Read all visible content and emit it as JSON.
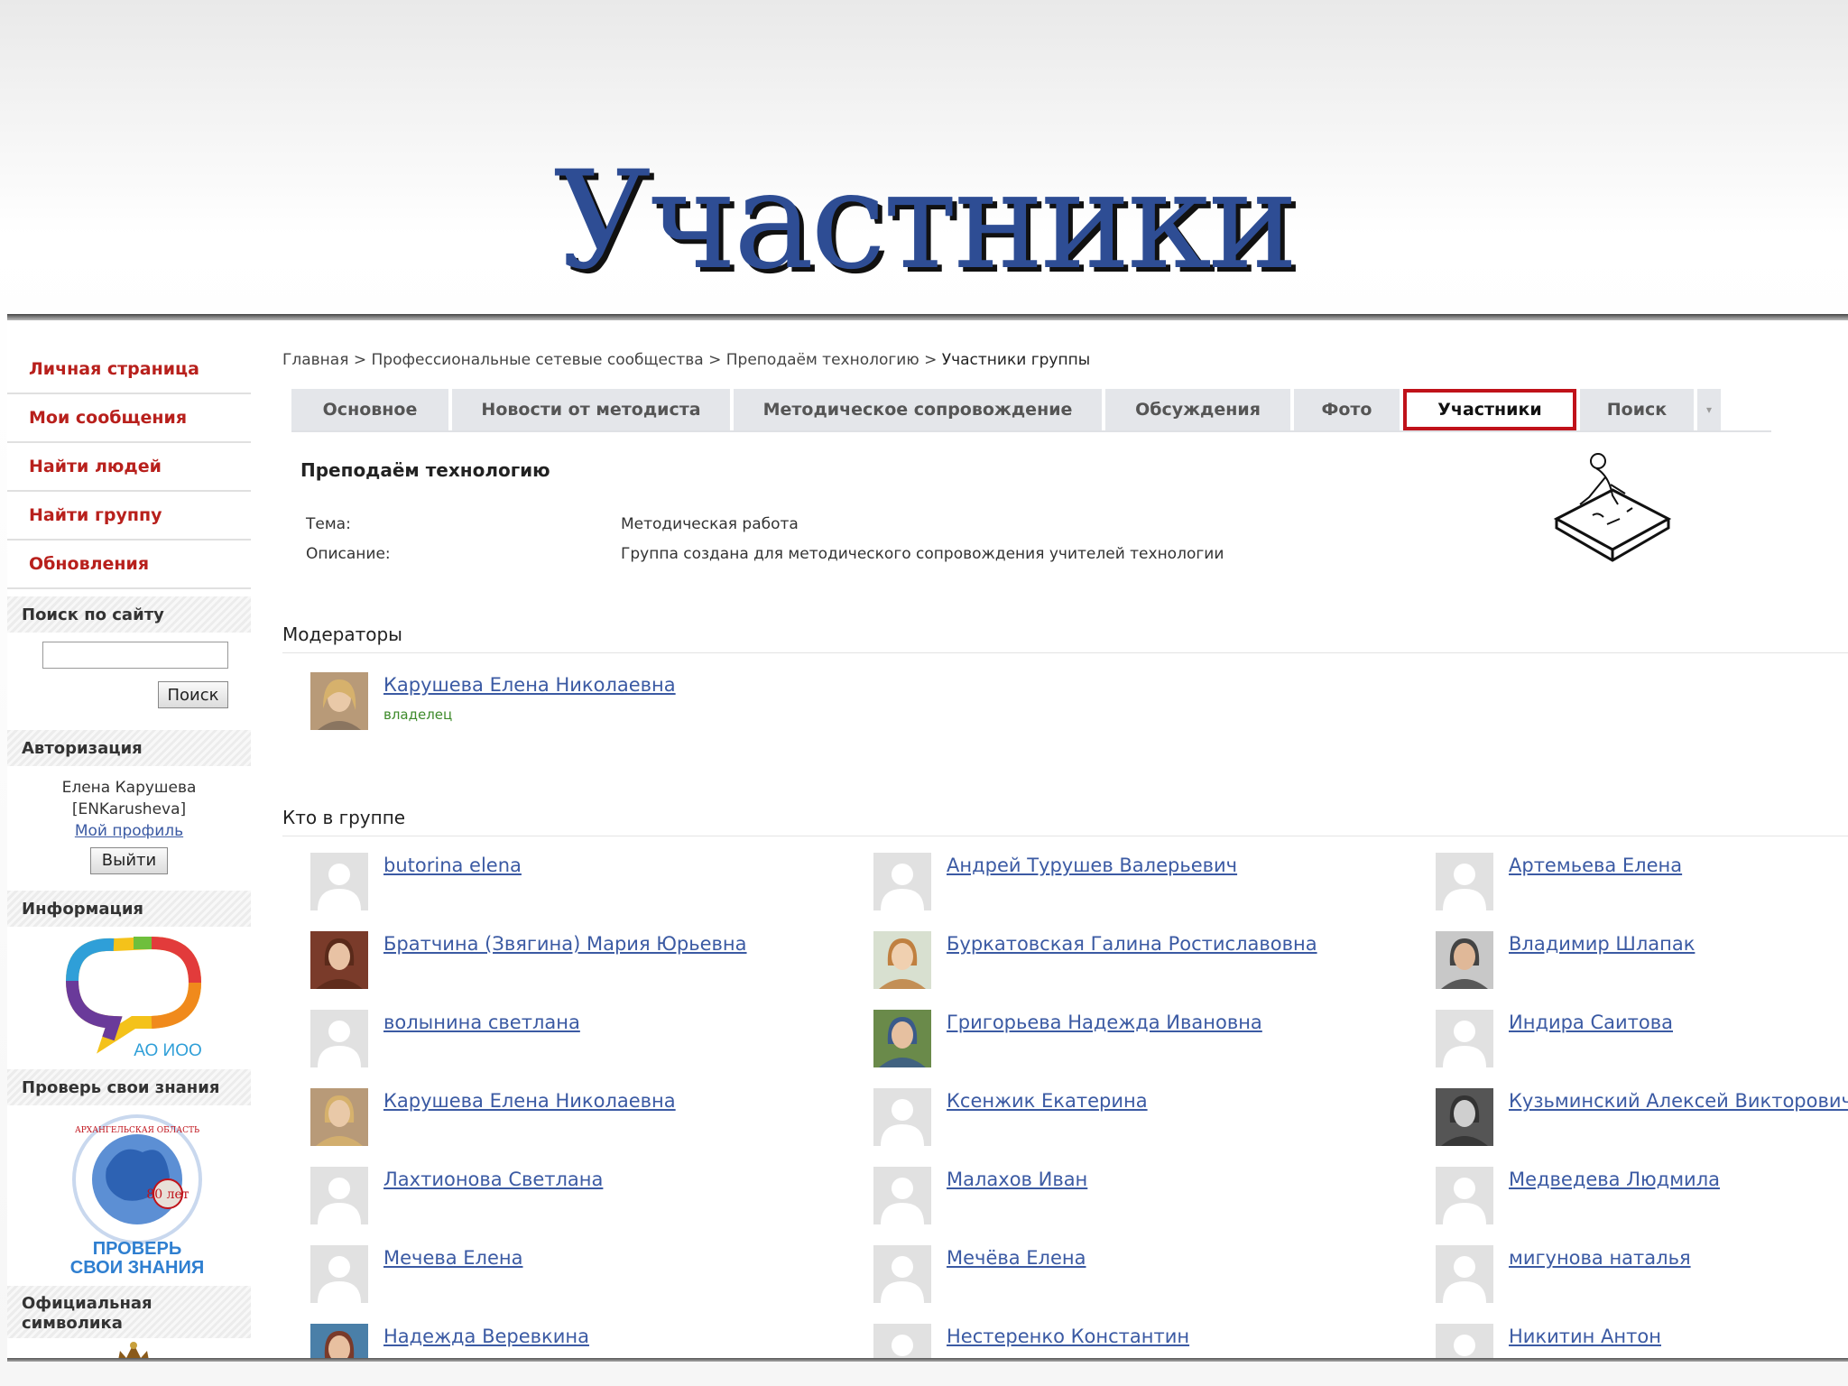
{
  "slide": {
    "title": "Участники"
  },
  "sidebar": {
    "nav": [
      "Личная страница",
      "Мои сообщения",
      "Найти людей",
      "Найти группу",
      "Обновления"
    ],
    "search": {
      "heading": "Поиск по сайту",
      "value": "",
      "button": "Поиск"
    },
    "auth": {
      "heading": "Авторизация",
      "name": "Елена Карушева",
      "login": "[ENKarusheva]",
      "profile_link": "Мой профиль",
      "logout": "Выйти"
    },
    "info": {
      "heading": "Информация",
      "logo_caption": "АО ИОО"
    },
    "quiz": {
      "heading": "Проверь свои знания",
      "line1": "ПРОВЕРЬ",
      "line2": "СВОИ ЗНАНИЯ",
      "seal_text": "АРХАНГЕЛЬСКАЯ ОБЛАСТЬ",
      "seal_years": "80 лет"
    },
    "symbols": {
      "heading_line1": "Официальная",
      "heading_line2": "символика"
    }
  },
  "breadcrumb": {
    "home": "Главная",
    "sep": ">",
    "level2": "Профессиональные сетевые сообщества",
    "level3": "Преподаём технологию",
    "current": "Участники группы"
  },
  "tabs": [
    "Основное",
    "Новости от методиста",
    "Методическое сопровождение",
    "Обсуждения",
    "Фото",
    "Участники",
    "Поиск"
  ],
  "active_tab": "Участники",
  "group": {
    "name": "Преподаём технологию",
    "topic_label": "Тема:",
    "topic": "Методическая работа",
    "desc_label": "Описание:",
    "desc": "Группа создана для методического сопровождения учителей технологии"
  },
  "moderators": {
    "heading": "Модераторы",
    "items": [
      {
        "name": "Карушева Елена Николаевна",
        "role": "владелец"
      }
    ]
  },
  "members": {
    "heading": "Кто в группе",
    "columns": [
      [
        "butorina elena",
        "Братчина (Звягина) Мария Юрьевна",
        "волынина светлана",
        "Карушева Елена Николаевна",
        "Лахтионова Светлана",
        "Мечева Елена",
        "Надежда Веревкина"
      ],
      [
        "Андрей Турушев Валерьевич",
        "Буркатовская Галина Ростиславовна",
        "Григорьева Надежда Ивановна",
        "Ксенжик Екатерина",
        "Малахов Иван",
        "Мечёва Елена",
        "Нестеренко Константин"
      ],
      [
        "Артемьева Елена",
        "Владимир Шлапак",
        "Индира Саитова",
        "Кузьминский Алексей Викторович",
        "Медведева Людмила",
        "мигунова наталья",
        "Никитин Антон"
      ]
    ]
  },
  "colors": {
    "nav_text": "#b8201c",
    "link": "#3b5aa3",
    "tab_bg": "#e4e6ea",
    "active_tab_border": "#c0121a",
    "title": "#2e4d94",
    "role_text": "#3d8a2a"
  }
}
